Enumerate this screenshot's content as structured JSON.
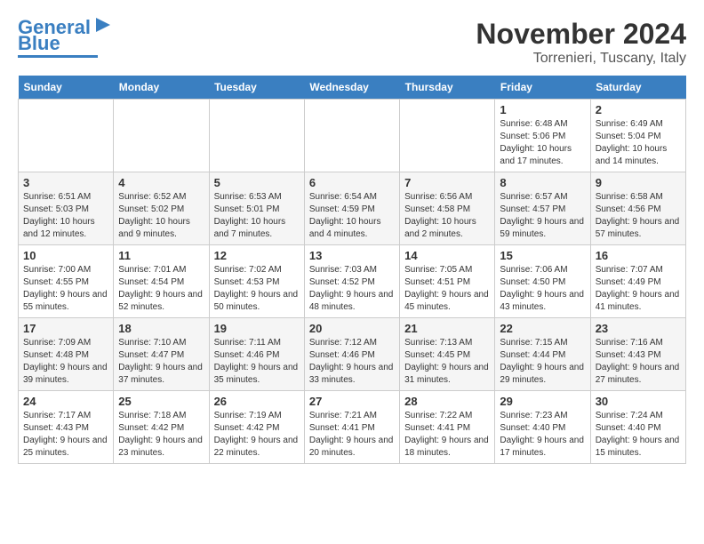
{
  "logo": {
    "line1": "General",
    "line2": "Blue"
  },
  "title": "November 2024",
  "subtitle": "Torrenieri, Tuscany, Italy",
  "days_of_week": [
    "Sunday",
    "Monday",
    "Tuesday",
    "Wednesday",
    "Thursday",
    "Friday",
    "Saturday"
  ],
  "weeks": [
    [
      {
        "day": "",
        "info": ""
      },
      {
        "day": "",
        "info": ""
      },
      {
        "day": "",
        "info": ""
      },
      {
        "day": "",
        "info": ""
      },
      {
        "day": "",
        "info": ""
      },
      {
        "day": "1",
        "info": "Sunrise: 6:48 AM\nSunset: 5:06 PM\nDaylight: 10 hours and 17 minutes."
      },
      {
        "day": "2",
        "info": "Sunrise: 6:49 AM\nSunset: 5:04 PM\nDaylight: 10 hours and 14 minutes."
      }
    ],
    [
      {
        "day": "3",
        "info": "Sunrise: 6:51 AM\nSunset: 5:03 PM\nDaylight: 10 hours and 12 minutes."
      },
      {
        "day": "4",
        "info": "Sunrise: 6:52 AM\nSunset: 5:02 PM\nDaylight: 10 hours and 9 minutes."
      },
      {
        "day": "5",
        "info": "Sunrise: 6:53 AM\nSunset: 5:01 PM\nDaylight: 10 hours and 7 minutes."
      },
      {
        "day": "6",
        "info": "Sunrise: 6:54 AM\nSunset: 4:59 PM\nDaylight: 10 hours and 4 minutes."
      },
      {
        "day": "7",
        "info": "Sunrise: 6:56 AM\nSunset: 4:58 PM\nDaylight: 10 hours and 2 minutes."
      },
      {
        "day": "8",
        "info": "Sunrise: 6:57 AM\nSunset: 4:57 PM\nDaylight: 9 hours and 59 minutes."
      },
      {
        "day": "9",
        "info": "Sunrise: 6:58 AM\nSunset: 4:56 PM\nDaylight: 9 hours and 57 minutes."
      }
    ],
    [
      {
        "day": "10",
        "info": "Sunrise: 7:00 AM\nSunset: 4:55 PM\nDaylight: 9 hours and 55 minutes."
      },
      {
        "day": "11",
        "info": "Sunrise: 7:01 AM\nSunset: 4:54 PM\nDaylight: 9 hours and 52 minutes."
      },
      {
        "day": "12",
        "info": "Sunrise: 7:02 AM\nSunset: 4:53 PM\nDaylight: 9 hours and 50 minutes."
      },
      {
        "day": "13",
        "info": "Sunrise: 7:03 AM\nSunset: 4:52 PM\nDaylight: 9 hours and 48 minutes."
      },
      {
        "day": "14",
        "info": "Sunrise: 7:05 AM\nSunset: 4:51 PM\nDaylight: 9 hours and 45 minutes."
      },
      {
        "day": "15",
        "info": "Sunrise: 7:06 AM\nSunset: 4:50 PM\nDaylight: 9 hours and 43 minutes."
      },
      {
        "day": "16",
        "info": "Sunrise: 7:07 AM\nSunset: 4:49 PM\nDaylight: 9 hours and 41 minutes."
      }
    ],
    [
      {
        "day": "17",
        "info": "Sunrise: 7:09 AM\nSunset: 4:48 PM\nDaylight: 9 hours and 39 minutes."
      },
      {
        "day": "18",
        "info": "Sunrise: 7:10 AM\nSunset: 4:47 PM\nDaylight: 9 hours and 37 minutes."
      },
      {
        "day": "19",
        "info": "Sunrise: 7:11 AM\nSunset: 4:46 PM\nDaylight: 9 hours and 35 minutes."
      },
      {
        "day": "20",
        "info": "Sunrise: 7:12 AM\nSunset: 4:46 PM\nDaylight: 9 hours and 33 minutes."
      },
      {
        "day": "21",
        "info": "Sunrise: 7:13 AM\nSunset: 4:45 PM\nDaylight: 9 hours and 31 minutes."
      },
      {
        "day": "22",
        "info": "Sunrise: 7:15 AM\nSunset: 4:44 PM\nDaylight: 9 hours and 29 minutes."
      },
      {
        "day": "23",
        "info": "Sunrise: 7:16 AM\nSunset: 4:43 PM\nDaylight: 9 hours and 27 minutes."
      }
    ],
    [
      {
        "day": "24",
        "info": "Sunrise: 7:17 AM\nSunset: 4:43 PM\nDaylight: 9 hours and 25 minutes."
      },
      {
        "day": "25",
        "info": "Sunrise: 7:18 AM\nSunset: 4:42 PM\nDaylight: 9 hours and 23 minutes."
      },
      {
        "day": "26",
        "info": "Sunrise: 7:19 AM\nSunset: 4:42 PM\nDaylight: 9 hours and 22 minutes."
      },
      {
        "day": "27",
        "info": "Sunrise: 7:21 AM\nSunset: 4:41 PM\nDaylight: 9 hours and 20 minutes."
      },
      {
        "day": "28",
        "info": "Sunrise: 7:22 AM\nSunset: 4:41 PM\nDaylight: 9 hours and 18 minutes."
      },
      {
        "day": "29",
        "info": "Sunrise: 7:23 AM\nSunset: 4:40 PM\nDaylight: 9 hours and 17 minutes."
      },
      {
        "day": "30",
        "info": "Sunrise: 7:24 AM\nSunset: 4:40 PM\nDaylight: 9 hours and 15 minutes."
      }
    ]
  ]
}
